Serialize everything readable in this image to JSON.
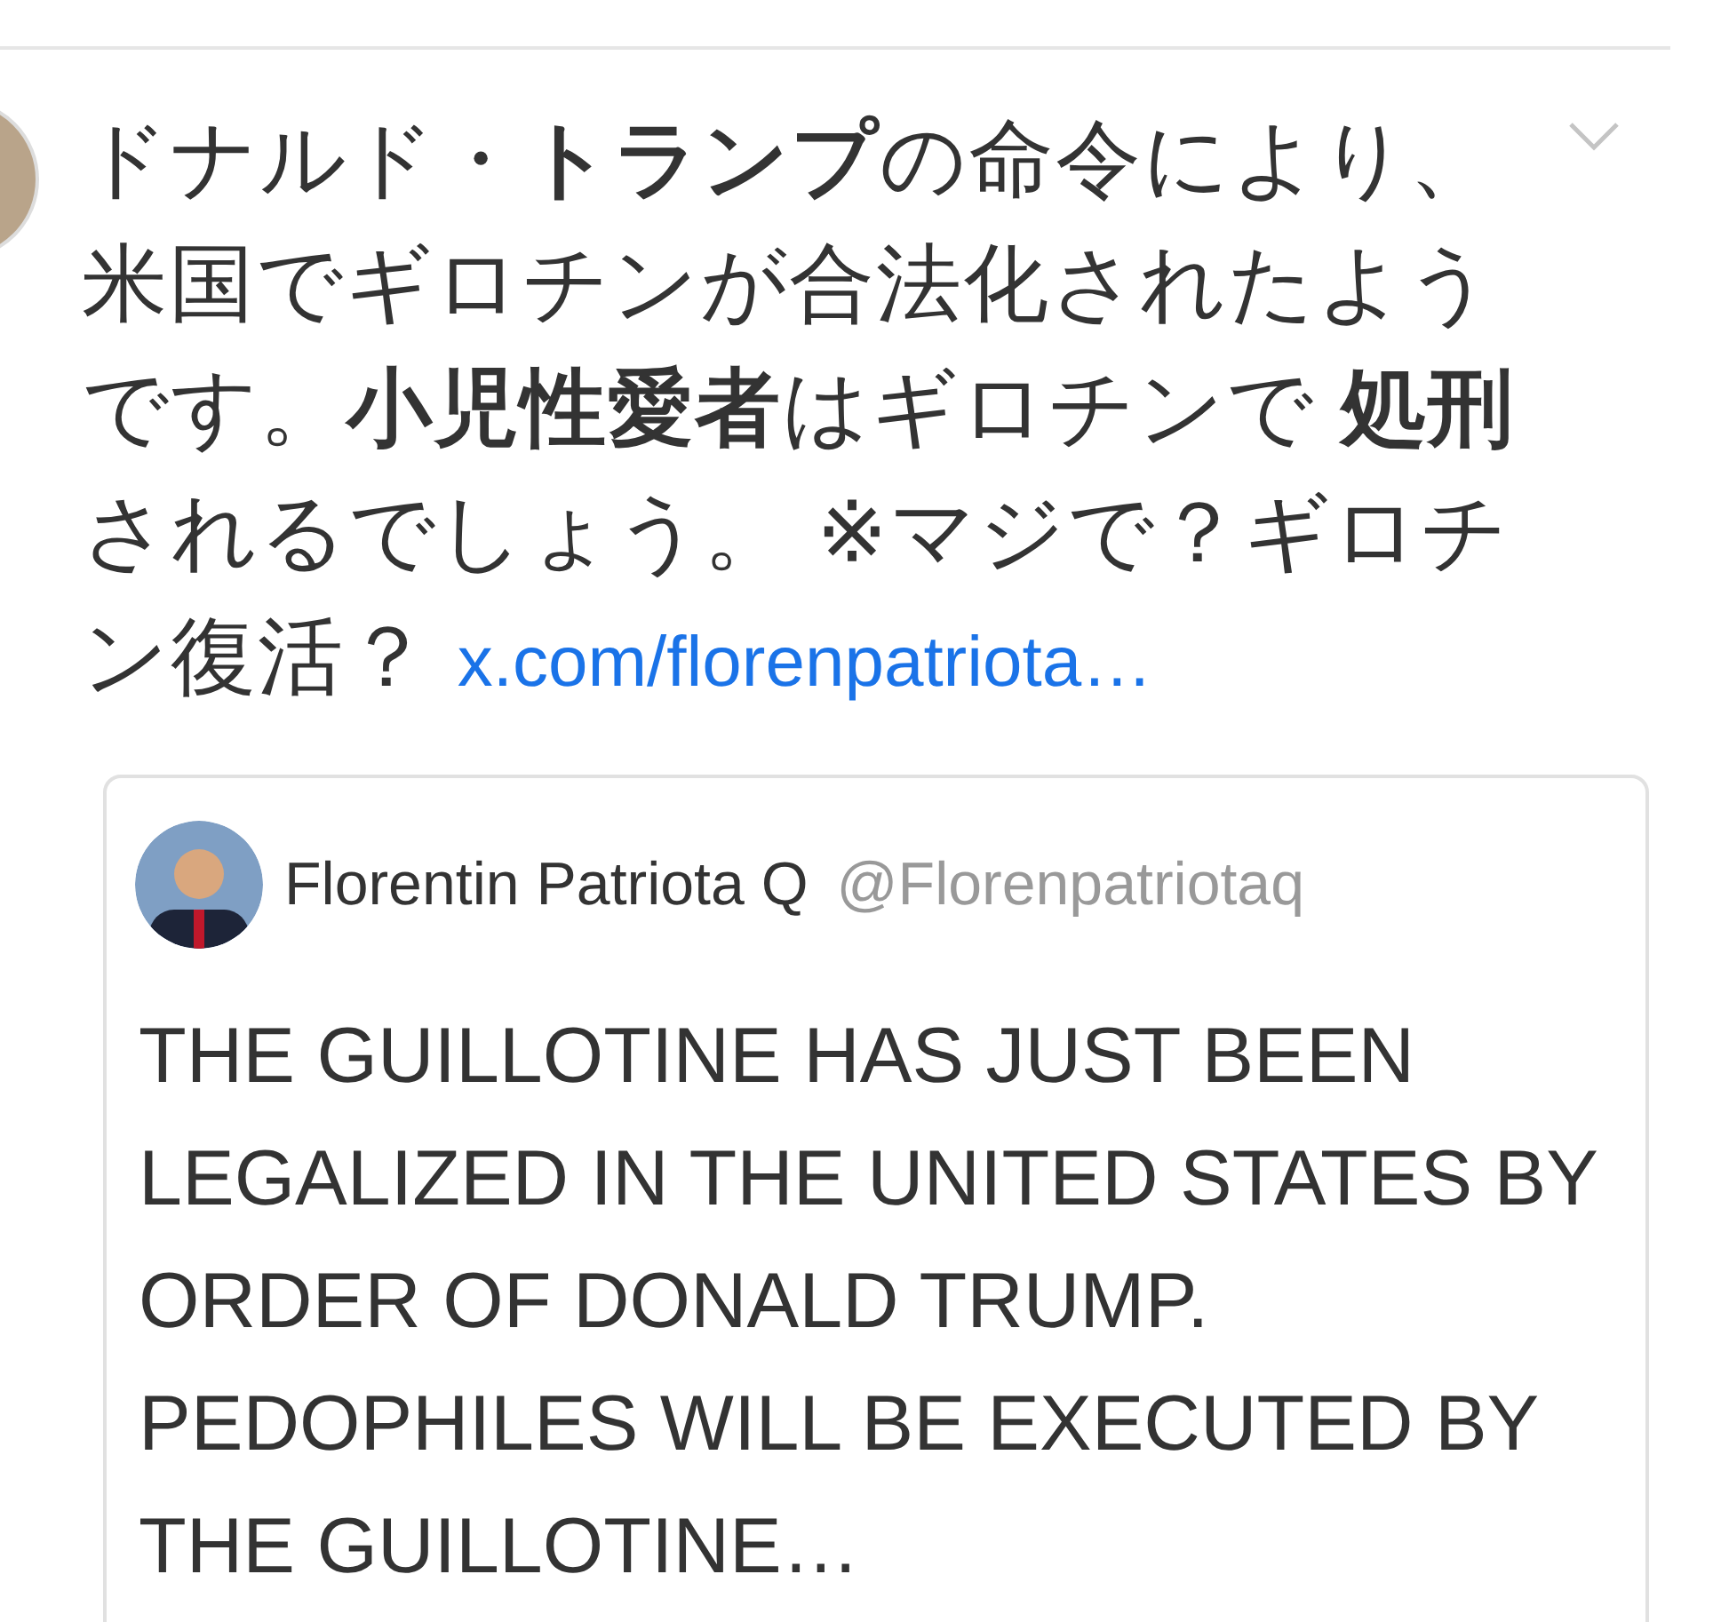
{
  "tweet": {
    "text": "ドナルド・**トランプ**の命令により、米国でギロチンが合法化されたようです。**小児性愛者**はギロチンで **処刑**されるでしょう。 ※マジで？ギロチン復活？",
    "link": "x.com/florenpatriota…"
  },
  "quoted_tweet": {
    "name": "Florentin Patriota Q",
    "handle": "@Florenpatriotaq",
    "text": "THE GUILLOTINE HAS JUST BEEN LEGALIZED IN THE UNITED STATES BY ORDER OF DONALD TRUMP. PEDOPHILES WILL BE EXECUTED BY THE GUILLOTINE…"
  }
}
